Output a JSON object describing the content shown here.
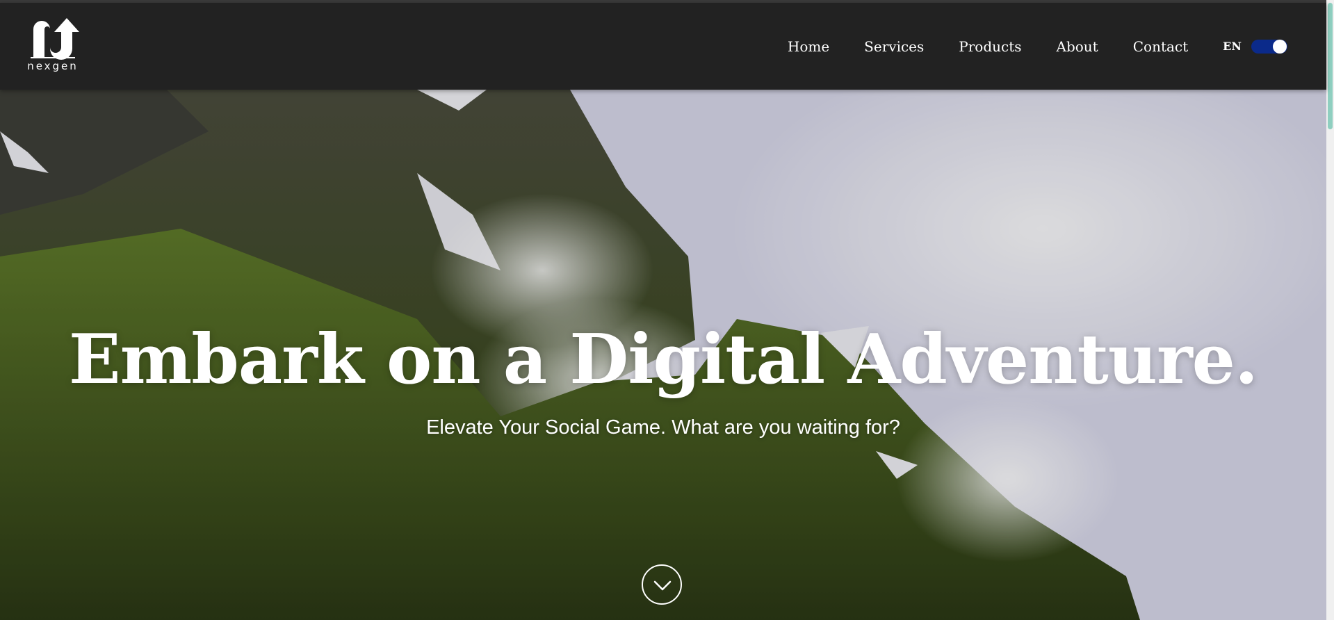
{
  "brand": {
    "name": "nexgen",
    "logo_icon": "arrow-up-logo-icon"
  },
  "nav": {
    "items": [
      {
        "label": "Home"
      },
      {
        "label": "Services"
      },
      {
        "label": "Products"
      },
      {
        "label": "About"
      },
      {
        "label": "Contact"
      }
    ],
    "language": "EN",
    "language_toggle_on": true
  },
  "hero": {
    "title": "Embark on a Digital Adventure.",
    "subtitle": "Elevate Your Social Game. What are you waiting for?",
    "scroll_icon": "chevron-down-icon"
  },
  "colors": {
    "navbar": "#222222",
    "toggle_on": "#0b2a8a",
    "text": "#ffffff"
  }
}
